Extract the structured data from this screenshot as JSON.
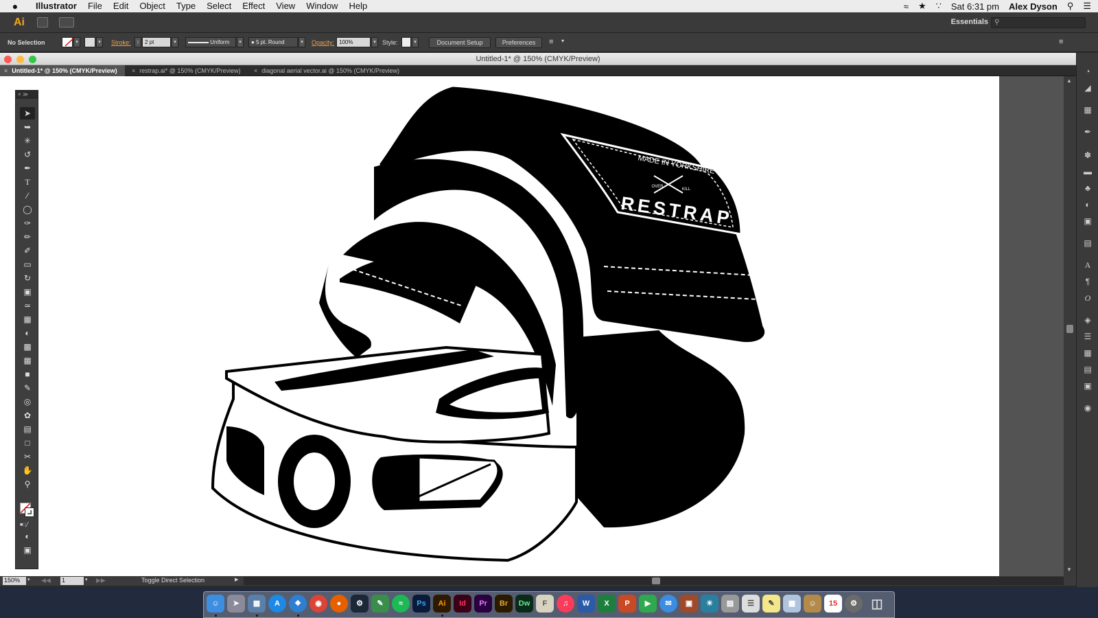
{
  "menubar": {
    "apple_label": "",
    "app_name": "Illustrator",
    "items": [
      "File",
      "Edit",
      "Object",
      "Type",
      "Select",
      "Effect",
      "View",
      "Window",
      "Help"
    ],
    "clock": "Sat 6:31 pm",
    "user": "Alex Dyson"
  },
  "appbar": {
    "logo": "Ai",
    "workspace": "Essentials",
    "search_placeholder": ""
  },
  "control": {
    "selection": "No Selection",
    "stroke_label": "Stroke:",
    "stroke_value": "2 pt",
    "profile": "Uniform",
    "brush": "5 pt. Round",
    "opacity_label": "Opacity:",
    "opacity_value": "100%",
    "style_label": "Style:",
    "document_setup": "Document Setup",
    "preferences": "Preferences"
  },
  "document": {
    "title": "Untitled-1* @ 150% (CMYK/Preview)",
    "tabs": [
      {
        "label": "Untitled-1* @ 150% (CMYK/Preview)",
        "active": true
      },
      {
        "label": "restrap.ai* @ 150% (CMYK/Preview)",
        "active": false
      },
      {
        "label": "diagonal aerial vector.ai @ 150% (CMYK/Preview)",
        "active": false
      }
    ]
  },
  "artwork": {
    "patch_arc": "MADE IN YORKSHIRE",
    "patch_left": "OVER",
    "patch_right": "KILL",
    "patch_brand": "RESTRAP"
  },
  "status": {
    "zoom": "150%",
    "page": "1",
    "tool_hint": "Toggle Direct Selection"
  },
  "tools": [
    "selection-tool",
    "direct-selection-tool",
    "magic-wand-tool",
    "lasso-tool",
    "pen-tool",
    "type-tool",
    "line-tool",
    "ellipse-tool",
    "paintbrush-tool",
    "pencil-tool",
    "blob-brush-tool",
    "eraser-tool",
    "rotate-tool",
    "scale-tool",
    "warp-tool",
    "free-transform-tool",
    "shape-builder-tool",
    "perspective-grid-tool",
    "mesh-tool",
    "gradient-tool",
    "eyedropper-tool",
    "blend-tool",
    "symbol-sprayer-tool",
    "column-graph-tool",
    "artboard-tool",
    "slice-tool",
    "hand-tool",
    "zoom-tool"
  ],
  "colors": {
    "accent": "#f4a521",
    "chrome": "#3a3a3a",
    "pasteboard": "#535353",
    "artwork": "#000000"
  }
}
